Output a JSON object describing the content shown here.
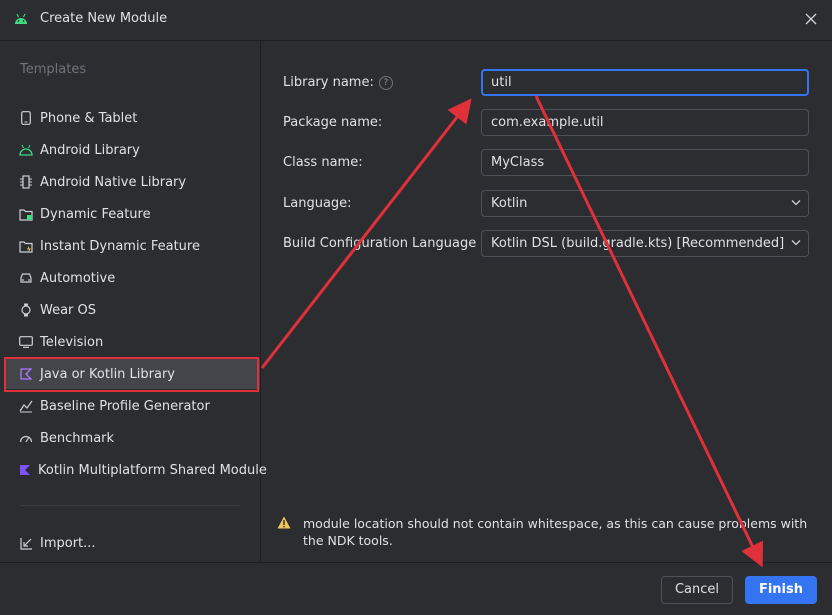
{
  "window": {
    "title": "Create New Module"
  },
  "sidebar": {
    "section_label": "Templates",
    "items": [
      {
        "label": "Phone & Tablet",
        "icon": "phone-icon"
      },
      {
        "label": "Android Library",
        "icon": "android-icon"
      },
      {
        "label": "Android Native Library",
        "icon": "native-library-icon"
      },
      {
        "label": "Dynamic Feature",
        "icon": "dynamic-feature-icon"
      },
      {
        "label": "Instant Dynamic Feature",
        "icon": "instant-feature-icon"
      },
      {
        "label": "Automotive",
        "icon": "car-icon"
      },
      {
        "label": "Wear OS",
        "icon": "watch-icon"
      },
      {
        "label": "Television",
        "icon": "tv-icon"
      },
      {
        "label": "Java or Kotlin Library",
        "icon": "kotlin-icon",
        "selected": true
      },
      {
        "label": "Baseline Profile Generator",
        "icon": "baseline-profile-icon"
      },
      {
        "label": "Benchmark",
        "icon": "benchmark-icon"
      },
      {
        "label": "Kotlin Multiplatform Shared Module",
        "icon": "kotlin-multiplatform-icon"
      }
    ],
    "import_label": "Import..."
  },
  "form": {
    "library_name": {
      "label": "Library name:",
      "value": "util"
    },
    "package_name": {
      "label": "Package name:",
      "value": "com.example.util"
    },
    "class_name": {
      "label": "Class name:",
      "value": "MyClass"
    },
    "language": {
      "label": "Language:",
      "value": "Kotlin"
    },
    "build_config": {
      "label": "Build Configuration Language",
      "value": "Kotlin DSL (build.gradle.kts) [Recommended]"
    }
  },
  "warning": {
    "text": "module location should not contain whitespace, as this can cause problems with the NDK tools."
  },
  "buttons": {
    "cancel": "Cancel",
    "finish": "Finish"
  },
  "colors": {
    "accent": "#3574f0",
    "annotation_red": "#e0303a",
    "warning": "#f2c55c"
  }
}
